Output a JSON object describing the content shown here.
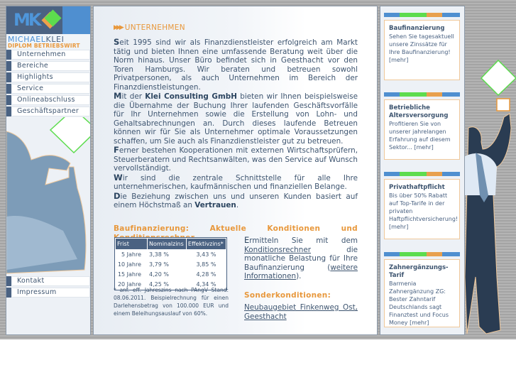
{
  "brand": {
    "logo_letters": "MK",
    "name_first": "MICHAEL",
    "name_last": "KLEI",
    "subtitle": "DIPLOM BETRIEBSWIRT",
    "colors": {
      "dark_blue": "#4a6282",
      "light_blue": "#4f8fd0",
      "green": "#5ddc4e",
      "orange": "#e8983c"
    }
  },
  "nav": {
    "primary": [
      {
        "label": "Unternehmen"
      },
      {
        "label": "Bereiche"
      },
      {
        "label": "Highlights"
      },
      {
        "label": "Service"
      },
      {
        "label": "Onlineabschluss"
      },
      {
        "label": "Geschäftspartner"
      }
    ],
    "secondary": [
      {
        "label": "Kontakt"
      },
      {
        "label": "Impressum"
      }
    ]
  },
  "main": {
    "section_title": "UNTERNEHMEN",
    "paragraphs": [
      {
        "cap": "S",
        "text": "eit 1995 sind wir als Finanzdienstleister erfolgreich am Markt tätig und bieten Ihnen eine umfassende Beratung weit über die Norm hinaus. Unser Büro befindet sich in Geesthacht vor den Toren Hamburgs. Wir beraten und betreuen sowohl Privatpersonen, als auch Unternehmen im Bereich der Finanzdienstleistungen."
      },
      {
        "cap": "M",
        "pre": "it der ",
        "bold": "Klei Consulting GmbH",
        "text": " bieten wir Ihnen beispielsweise die Übernahme der Buchung Ihrer laufenden Geschäftsvorfälle für Ihr Unternehmen sowie die Erstellung von Lohn- und Gehaltsabrechnungen an. Durch dieses laufende Betreuen können wir für Sie als Unternehmer optimale Voraussetzungen schaffen, um Sie auch als Finanzdienstleister gut zu betreuen."
      },
      {
        "cap": "F",
        "text": "erner bestehen Kooperationen mit externen Wirtschaftsprüfern, Steuerberatern und Rechtsanwälten, was den Service auf Wunsch vervollständigt."
      },
      {
        "cap": "W",
        "text": "ir sind die zentrale Schnittstelle für alle Ihre unternehmerischen, kaufmännischen und finanziellen Belange."
      },
      {
        "cap": "D",
        "text": "ie Beziehung zwischen uns und unseren Kunden basiert auf einem Höchstmaß an ",
        "bold": "Vertrauen",
        "post": "."
      }
    ],
    "bau_heading": {
      "w1": "Baufinanzierung:",
      "w2": "Aktuelle",
      "w3": "Konditionen",
      "w4": "und",
      "line2": "Konditionsrechner"
    },
    "rates_table": {
      "headers": [
        "Frist",
        "Nominalzins",
        "Effektivzins*"
      ],
      "rows": [
        [
          "5 Jahre",
          "3,38 %",
          "3,43 %"
        ],
        [
          "10 Jahre",
          "3,79 %",
          "3,85 %"
        ],
        [
          "15 Jahre",
          "4,20 %",
          "4,28 %"
        ],
        [
          "20 Jahre",
          "4,25 %",
          "4,34 %"
        ]
      ]
    },
    "footnote": "* anf. eff. Jahreszins nach PAngV Stand: 08.06.2011. Beispielrechnung für einen Darlehensbetrag von 100.000 EUR und einem Beleihungsauslauf von 60%.",
    "calc": {
      "cap": "E",
      "pre": "rmitteln Sie mit dem ",
      "link1": "Konditionsrechner",
      "mid": " die monatliche Belastung für Ihre Baufinanzierung (",
      "link2": "weitere Informationen",
      "post": ")."
    },
    "sonder_title": "Sonderkonditionen:",
    "sonder_link": "Neubaugebiet Finkenweg Ost, Geesthacht"
  },
  "teasers": [
    {
      "title": "Baufinanzierung",
      "text": "Sehen Sie tagesaktuell unsere Zinssätze für Ihre Baufinanzierung! [mehr]"
    },
    {
      "title": "Betriebliche Altersversorgung",
      "text": "Profitieren Sie von unserer jahrelangen Erfahrung auf diesem Sektor... [mehr]"
    },
    {
      "title": "Privathaftpflicht",
      "text": "Bis über 50% Rabatt auf Top-Tarife in der privaten Haftpflichtversicherung! [mehr]"
    },
    {
      "title": "Zahnergänzungs-Tarif",
      "text": "Barmenia Zahnergänzung ZG: Bester Zahntarif Deutschlands sagt Finanztest und Focus Money [mehr]"
    }
  ]
}
